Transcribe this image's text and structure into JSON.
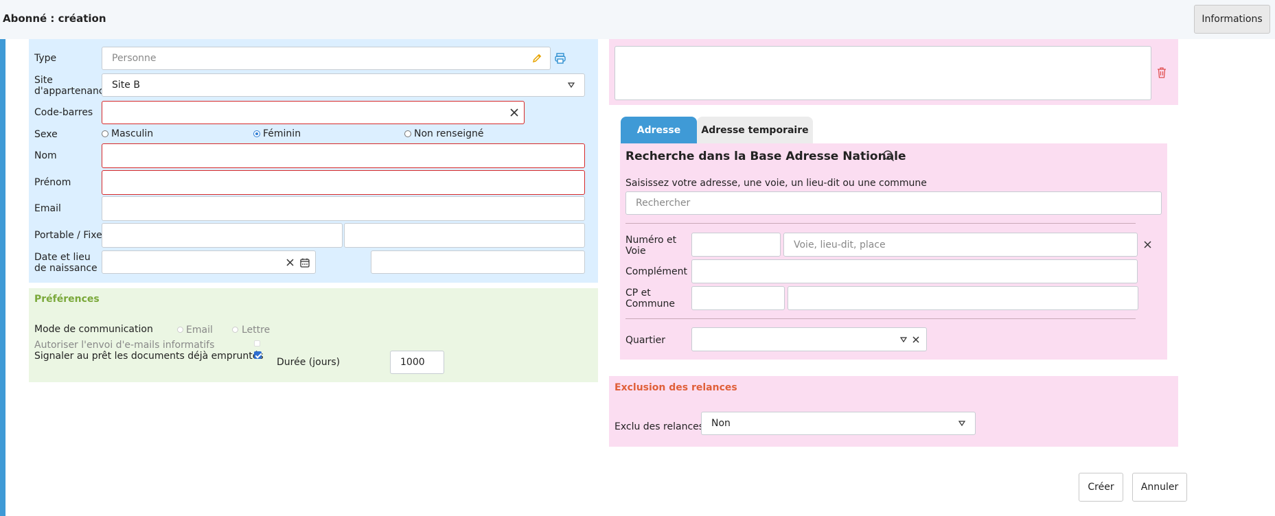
{
  "header": {
    "title": "Abonné : création",
    "info_button": "Informations"
  },
  "identity": {
    "type_label": "Type",
    "type_value": "Personne",
    "site_label": "Site d'appartenance",
    "site_value": "Site B",
    "barcode_label": "Code-barres",
    "sexe_label": "Sexe",
    "sexe_options": [
      "Masculin",
      "Féminin",
      "Non renseigné"
    ],
    "sexe_selected": "Féminin",
    "nom_label": "Nom",
    "prenom_label": "Prénom",
    "email_label": "Email",
    "phone_label": "Portable / Fixe",
    "birth_label": "Date et lieu de naissance"
  },
  "preferences": {
    "title": "Préférences",
    "mode_label": "Mode de communication",
    "mode_options": [
      "Email",
      "Lettre"
    ],
    "mode_selected": "Lettre",
    "emails_label": "Autoriser l'envoi d'e-mails informatifs",
    "emails_checked": false,
    "signal_label": "Signaler au prêt les documents déjà empruntés",
    "signal_checked": true,
    "duree_label": "Durée (jours)",
    "duree_value": "1000"
  },
  "address": {
    "tabs": [
      "Adresse",
      "Adresse temporaire"
    ],
    "active_tab": "Adresse",
    "ban_title": "Recherche dans la Base Adresse Nationale",
    "ban_help": "Saisissez votre adresse, une voie, un lieu-dit ou une commune",
    "search_placeholder": "Rechercher",
    "numero_label": "Numéro et Voie",
    "voie_placeholder": "Voie, lieu-dit, place",
    "complement_label": "Complément",
    "cp_label": "CP et Commune",
    "quartier_label": "Quartier"
  },
  "exclusion": {
    "title": "Exclusion des relances",
    "label": "Exclu des relances",
    "value": "Non"
  },
  "actions": {
    "create": "Créer",
    "cancel": "Annuler"
  },
  "colors": {
    "accent": "#3f9ad6",
    "error": "#d62828",
    "pink": "#fbddf1",
    "blue": "#dcefff",
    "green": "#ebf6e3"
  }
}
